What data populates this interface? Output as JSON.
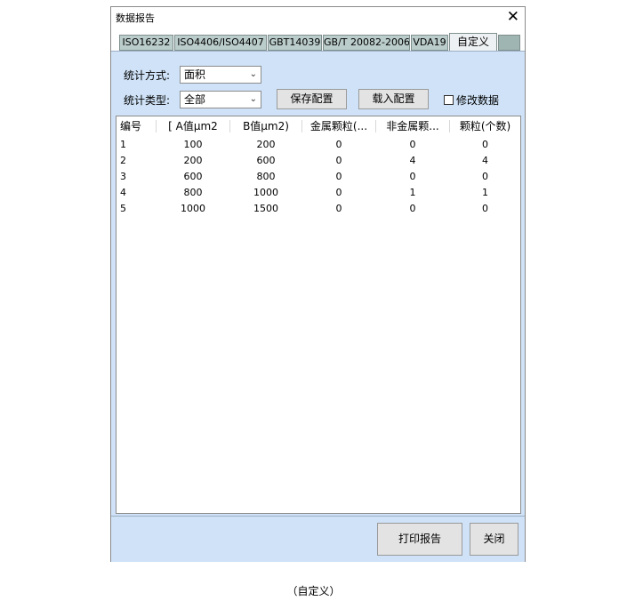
{
  "window": {
    "title": "数据报告",
    "close_glyph": "✕"
  },
  "tabs": [
    {
      "label": "ISO16232"
    },
    {
      "label": "ISO4406/ISO4407"
    },
    {
      "label": "GBT14039"
    },
    {
      "label": "GB/T 20082-2006"
    },
    {
      "label": "VDA19"
    },
    {
      "label": "自定义",
      "active": true
    }
  ],
  "controls": {
    "stat_method_label": "统计方式:",
    "stat_method_value": "面积",
    "stat_type_label": "统计类型:",
    "stat_type_value": "全部",
    "save_config": "保存配置",
    "load_config": "载入配置",
    "modify_data_label": "修改数据",
    "modify_data_checked": false
  },
  "table": {
    "columns": [
      "编号",
      "[ A值μm2",
      "B值μm2)",
      "金属颗粒(...",
      "非金属颗...",
      "颗粒(个数)"
    ],
    "rows": [
      [
        "1",
        "100",
        "200",
        "0",
        "0",
        "0"
      ],
      [
        "2",
        "200",
        "600",
        "0",
        "4",
        "4"
      ],
      [
        "3",
        "600",
        "800",
        "0",
        "0",
        "0"
      ],
      [
        "4",
        "800",
        "1000",
        "0",
        "1",
        "1"
      ],
      [
        "5",
        "1000",
        "1500",
        "0",
        "0",
        "0"
      ]
    ]
  },
  "footer": {
    "print_report": "打印报告",
    "close": "关闭"
  },
  "caption": "（自定义）"
}
